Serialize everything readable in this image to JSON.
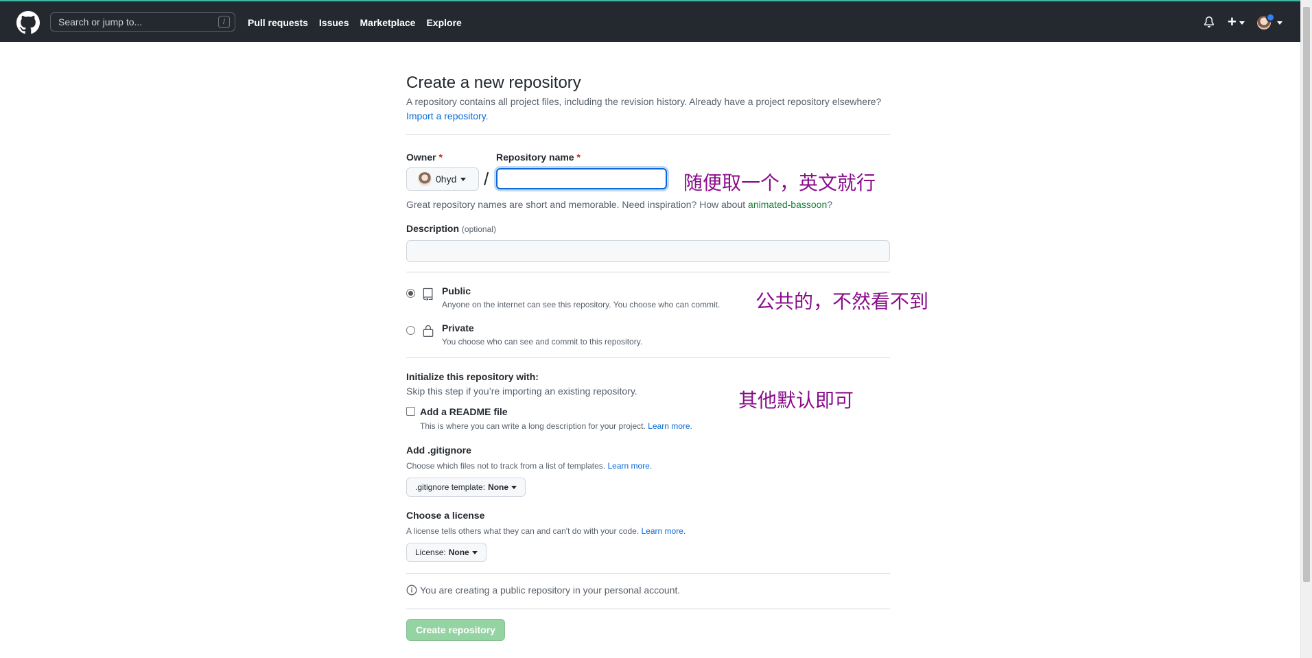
{
  "header": {
    "search_placeholder": "Search or jump to...",
    "search_shortcut": "/",
    "nav": [
      "Pull requests",
      "Issues",
      "Marketplace",
      "Explore"
    ],
    "plus_label": "+"
  },
  "form": {
    "title": "Create a new repository",
    "subtitle": "A repository contains all project files, including the revision history. Already have a project repository elsewhere?",
    "import_link": "Import a repository.",
    "owner_label": "Owner",
    "required_mark": "*",
    "owner_value": "0hyd",
    "repo_name_label": "Repository name",
    "separator": "/",
    "repo_name_value": "",
    "hint_prefix": "Great repository names are short and memorable. Need inspiration? How about ",
    "hint_suggestion": "animated-bassoon",
    "hint_suffix": "?",
    "description_label": "Description",
    "description_optional": "(optional)",
    "visibility": {
      "public_title": "Public",
      "public_desc": "Anyone on the internet can see this repository. You choose who can commit.",
      "private_title": "Private",
      "private_desc": "You choose who can see and commit to this repository.",
      "selected": "public"
    },
    "init_title": "Initialize this repository with:",
    "init_desc": "Skip this step if you’re importing an existing repository.",
    "readme_label": "Add a README file",
    "readme_desc": "This is where you can write a long description for your project.",
    "learn_more": "Learn more.",
    "gitignore_title": "Add .gitignore",
    "gitignore_desc": "Choose which files not to track from a list of templates.",
    "gitignore_select_prefix": ".gitignore template: ",
    "gitignore_select_value": "None",
    "license_title": "Choose a license",
    "license_desc": "A license tells others what they can and can't do with your code.",
    "license_select_prefix": "License: ",
    "license_select_value": "None",
    "info_text": "You are creating a public repository in your personal account.",
    "create_button": "Create repository"
  },
  "annotations": {
    "name_note": "随便取一个，英文就行",
    "public_note": "公共的，不然看不到",
    "default_note": "其他默认即可",
    "color": "#8a0c8c"
  }
}
